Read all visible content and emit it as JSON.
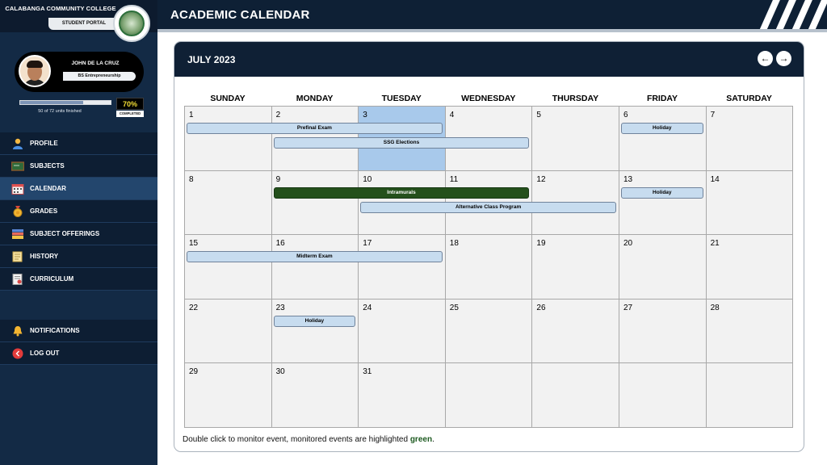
{
  "brand": {
    "college_name": "CALABANGA COMMUNITY COLLEGE",
    "portal_label": "STUDENT PORTAL"
  },
  "user": {
    "name": "JOHN DE LA CRUZ",
    "course": "BS Entrepreneurship",
    "units_text": "50 of 72 units finished",
    "progress_label": "70%",
    "progress_fraction": 0.7,
    "completed_label": "COMPLETED"
  },
  "nav": {
    "items": [
      {
        "label": "PROFILE",
        "icon": "profile-icon",
        "active": false
      },
      {
        "label": "SUBJECTS",
        "icon": "chalkboard-icon",
        "active": false
      },
      {
        "label": "CALENDAR",
        "icon": "calendar-icon",
        "active": true
      },
      {
        "label": "GRADES",
        "icon": "medal-icon",
        "active": false
      },
      {
        "label": "SUBJECT OFFERINGS",
        "icon": "books-icon",
        "active": false
      },
      {
        "label": "HISTORY",
        "icon": "scroll-icon",
        "active": false
      },
      {
        "label": "CURRICULUM",
        "icon": "certificate-icon",
        "active": false
      }
    ],
    "secondary": [
      {
        "label": "NOTIFICATIONS",
        "icon": "bell-icon"
      },
      {
        "label": "LOG OUT",
        "icon": "logout-icon"
      }
    ]
  },
  "page": {
    "title": "ACADEMIC CALENDAR"
  },
  "calendar": {
    "month_label": "JULY 2023",
    "prev_label": "←",
    "next_label": "→",
    "weekdays": [
      "SUNDAY",
      "MONDAY",
      "TUESDAY",
      "WEDNESDAY",
      "THURSDAY",
      "FRIDAY",
      "SATURDAY"
    ],
    "weeks": [
      [
        "1",
        "2",
        "3",
        "4",
        "5",
        "6",
        "7"
      ],
      [
        "8",
        "9",
        "10",
        "11",
        "12",
        "13",
        "14"
      ],
      [
        "15",
        "16",
        "17",
        "18",
        "19",
        "20",
        "21"
      ],
      [
        "22",
        "23",
        "24",
        "25",
        "26",
        "27",
        "28"
      ],
      [
        "29",
        "30",
        "31",
        "",
        "",
        "",
        ""
      ]
    ],
    "highlighted_day": "3",
    "events": [
      {
        "label": "Prefinal Exam",
        "start": "1",
        "end": "3",
        "monitored": false
      },
      {
        "label": "SSG Elections",
        "start": "2",
        "end": "4",
        "monitored": false
      },
      {
        "label": "Holiday",
        "start": "6",
        "end": "6",
        "monitored": false
      },
      {
        "label": "Intramurals",
        "start": "9",
        "end": "11",
        "monitored": true
      },
      {
        "label": "Alternative Class Program",
        "start": "10",
        "end": "12",
        "monitored": false
      },
      {
        "label": "Holiday",
        "start": "13",
        "end": "13",
        "monitored": false
      },
      {
        "label": "Midterm Exam",
        "start": "15",
        "end": "17",
        "monitored": false
      },
      {
        "label": "Holiday",
        "start": "23",
        "end": "23",
        "monitored": false
      }
    ],
    "footer_prefix": "Double click to monitor event, monitored events are highlighted ",
    "footer_highlight": "green",
    "footer_suffix": ".",
    "monitored_color": "#24501c",
    "event_color": "#c7dcef"
  }
}
